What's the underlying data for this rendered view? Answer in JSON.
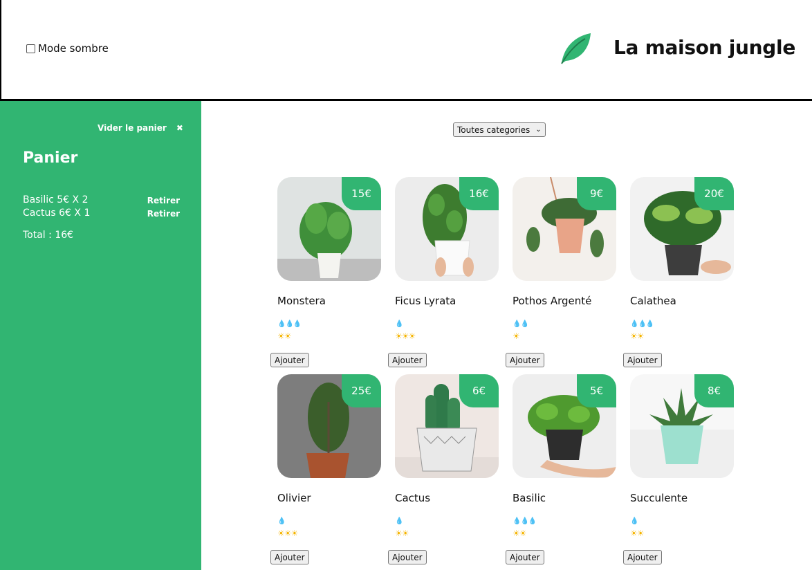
{
  "header": {
    "dark_mode_label": "Mode sombre",
    "title": "La maison jungle",
    "logo_icon": "leaf-icon"
  },
  "cart": {
    "empty_label": "Vider le panier",
    "title": "Panier",
    "items": [
      {
        "text": "Basilic 5€ X 2",
        "remove_label": "Retirer"
      },
      {
        "text": "Cactus 6€ X 1",
        "remove_label": "Retirer"
      }
    ],
    "total": "Total : 16€"
  },
  "filter": {
    "selected": "Toutes categories"
  },
  "plants": [
    {
      "name": "Monstera",
      "price": "15€",
      "water": 3,
      "light": 2,
      "add_label": "Ajouter"
    },
    {
      "name": "Ficus Lyrata",
      "price": "16€",
      "water": 1,
      "light": 3,
      "add_label": "Ajouter"
    },
    {
      "name": "Pothos Argenté",
      "price": "9€",
      "water": 2,
      "light": 1,
      "add_label": "Ajouter"
    },
    {
      "name": "Calathea",
      "price": "20€",
      "water": 3,
      "light": 2,
      "add_label": "Ajouter"
    },
    {
      "name": "Olivier",
      "price": "25€",
      "water": 1,
      "light": 3,
      "add_label": "Ajouter"
    },
    {
      "name": "Cactus",
      "price": "6€",
      "water": 1,
      "light": 2,
      "add_label": "Ajouter"
    },
    {
      "name": "Basilic",
      "price": "5€",
      "water": 3,
      "light": 2,
      "add_label": "Ajouter"
    },
    {
      "name": "Succulente",
      "price": "8€",
      "water": 1,
      "light": 2,
      "add_label": "Ajouter"
    }
  ],
  "colors": {
    "accent": "#31b572",
    "water": "#3b93d6",
    "sun": "#f5b400"
  }
}
